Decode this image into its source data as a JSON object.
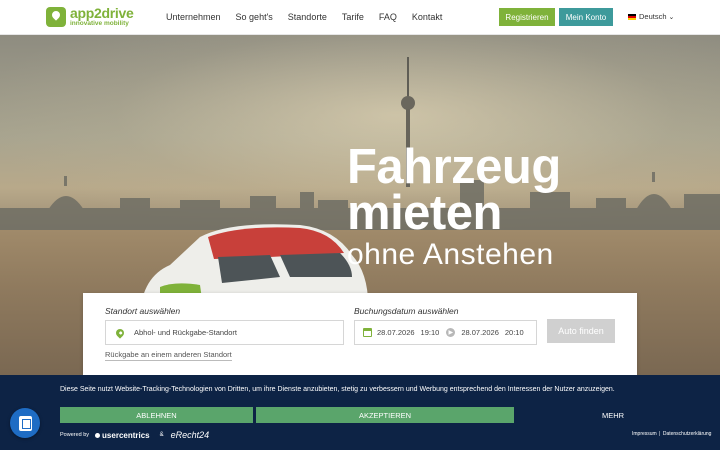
{
  "brand": {
    "name": "app2drive",
    "tagline": "innovative mobility",
    "color": "#7fb23a"
  },
  "nav": {
    "items": [
      "Unternehmen",
      "So geht's",
      "Standorte",
      "Tarife",
      "FAQ",
      "Kontakt"
    ]
  },
  "header": {
    "register_label": "Registrieren",
    "account_label": "Mein Konto",
    "language_label": "Deutsch"
  },
  "hero": {
    "line1": "Fahrzeug",
    "line2": "mieten",
    "line3": "ohne Anstehen"
  },
  "booking": {
    "location_label": "Standort auswählen",
    "location_placeholder": "Abhol- und Rückgabe-Standort",
    "return_link": "Rückgabe an einem anderen Standort",
    "date_label": "Buchungsdatum auswählen",
    "start_date": "28.07.2026",
    "start_time": "19:10",
    "end_date": "28.07.2026",
    "end_time": "20:10",
    "find_label": "Auto finden"
  },
  "cookie": {
    "text": "Diese Seite nutzt Website-Tracking-Technologien von Dritten, um ihre Dienste anzubieten, stetig zu verbessern und Werbung entsprechend den Interessen der Nutzer anzuzeigen.",
    "deny_label": "ABLEHNEN",
    "accept_label": "AKZEPTIEREN",
    "more_label": "MEHR",
    "powered_by": "Powered by",
    "usercentrics": "usercentrics",
    "amp": "&",
    "erecht": "eRecht24",
    "imprint": "Impressum",
    "privacy": "Datenschutzerklärung",
    "background": "#0d2345",
    "button_color": "#5aa56b"
  }
}
